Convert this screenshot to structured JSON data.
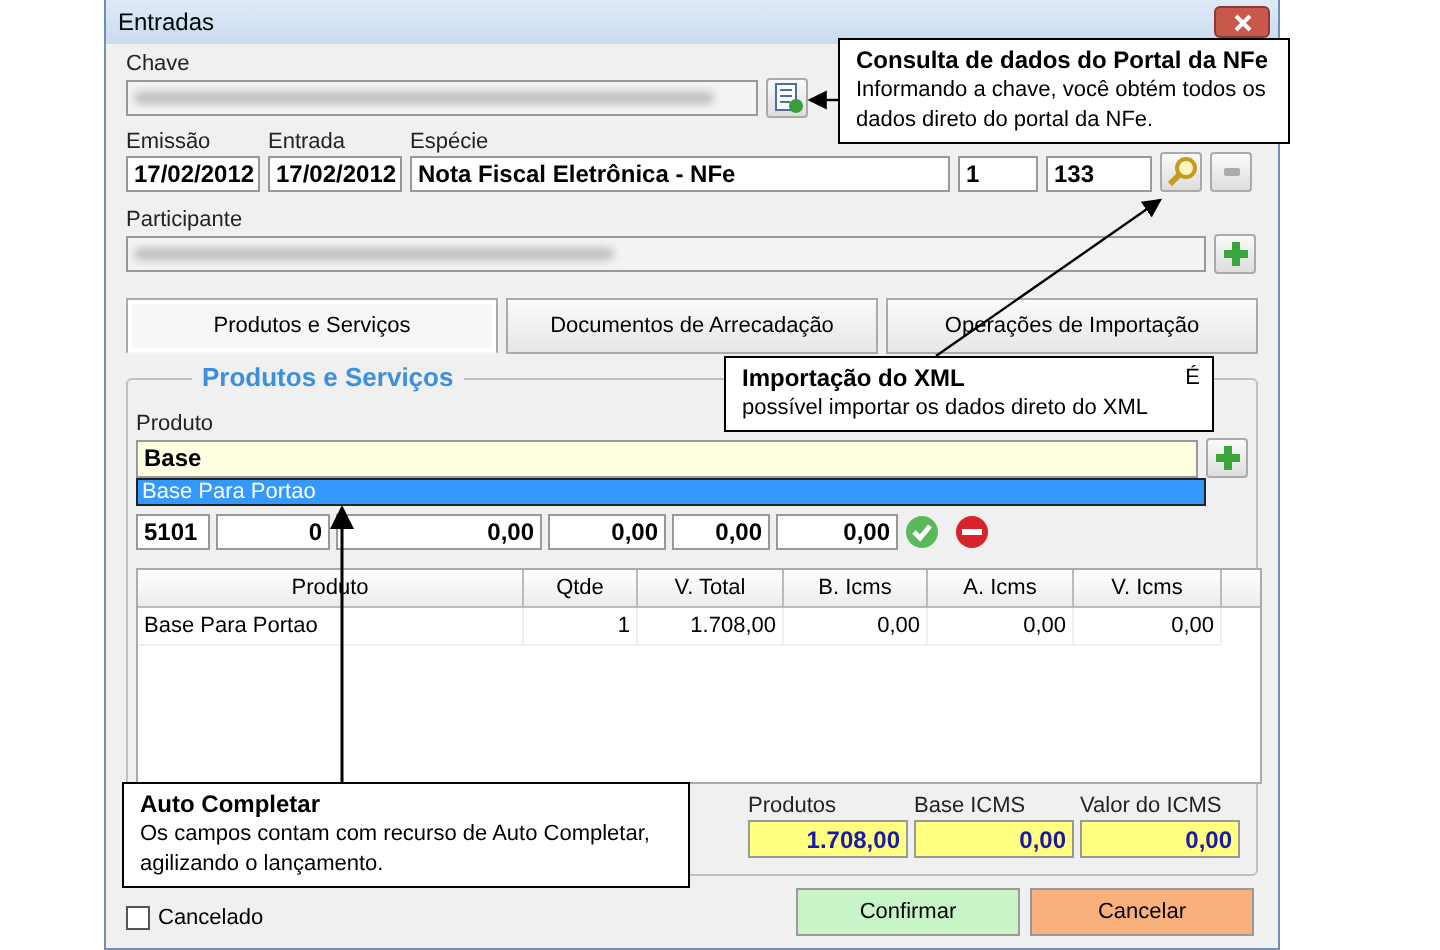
{
  "window": {
    "title": "Entradas"
  },
  "chave": {
    "label": "Chave"
  },
  "header_fields": [
    {
      "label": "Emissão",
      "value": "17/02/2012"
    },
    {
      "label": "Entrada",
      "value": "17/02/2012"
    },
    {
      "label": "Espécie",
      "value": "Nota Fiscal Eletrônica - NFe"
    },
    {
      "value": "1"
    },
    {
      "value": "133"
    }
  ],
  "participante": {
    "label": "Participante"
  },
  "tabs": [
    {
      "label": "Produtos e Serviços",
      "selected": true
    },
    {
      "label": "Documentos de Arrecadação",
      "selected": false
    },
    {
      "label": "Operações de Importação",
      "selected": false
    }
  ],
  "group": {
    "title": "Produtos e Serviços",
    "product_label": "Produto",
    "product_value": "Base",
    "suggestions": [
      {
        "text": "Base Para Portao",
        "selected": true
      }
    ],
    "item_fields": [
      "5101",
      "0",
      "0,00",
      "0,00",
      "0,00",
      "0,00"
    ]
  },
  "table": {
    "columns": [
      "Produto",
      "Qtde",
      "V. Total",
      "B. Icms",
      "A. Icms",
      "V. Icms"
    ],
    "rows": [
      [
        "Base Para Portao",
        "1",
        "1.708,00",
        "0,00",
        "0,00",
        "0,00"
      ]
    ]
  },
  "totals": [
    {
      "label": "Produtos",
      "value": "1.708,00"
    },
    {
      "label": "Base ICMS",
      "value": "0,00"
    },
    {
      "label": "Valor do ICMS",
      "value": "0,00"
    }
  ],
  "cancelado": {
    "label": "Cancelado",
    "checked": false
  },
  "buttons": [
    {
      "label": "Confirmar",
      "kind": "confirm"
    },
    {
      "label": "Cancelar",
      "kind": "cancel"
    }
  ],
  "callouts": [
    {
      "title": "Consulta de dados do Portal da NFe",
      "text": "Informando a chave, você obtém todos os dados direto do portal da NFe."
    },
    {
      "title": "Importação do XML",
      "lead": "É",
      "text": "possível importar os dados direto do XML"
    },
    {
      "title": "Auto Completar",
      "text": "Os campos contam com recurso de Auto Completar, agilizando o lançamento."
    }
  ]
}
